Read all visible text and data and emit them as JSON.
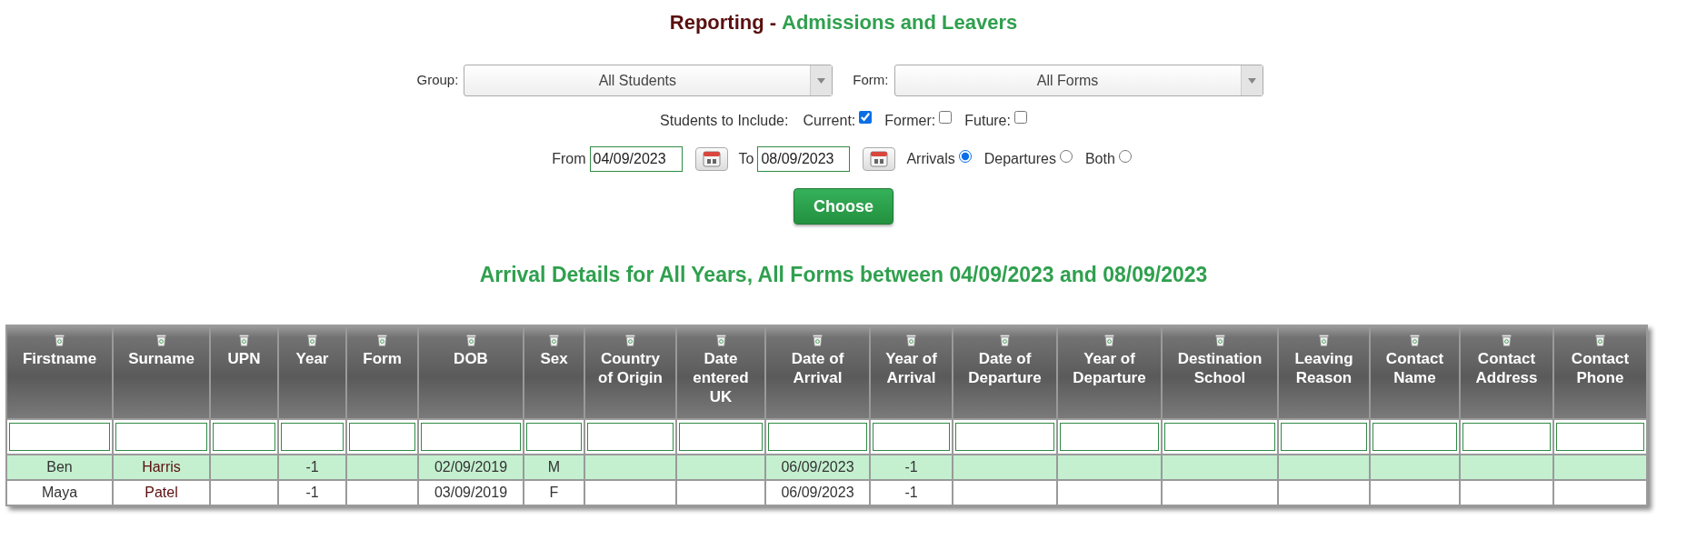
{
  "title": {
    "section": "Reporting",
    "separator": "-",
    "page": "Admissions and Leavers"
  },
  "selects": [
    {
      "label": "Group:",
      "value": "All Students"
    },
    {
      "label": "Form:",
      "value": "All Forms"
    }
  ],
  "include": {
    "label": "Students to Include:",
    "options": [
      {
        "label": "Current:",
        "checked": true
      },
      {
        "label": "Former:",
        "checked": false
      },
      {
        "label": "Future:",
        "checked": false
      }
    ]
  },
  "dates": [
    {
      "label": "From",
      "value": "04/09/2023"
    },
    {
      "label": "To",
      "value": "08/09/2023"
    }
  ],
  "direction": [
    {
      "label": "Arrivals",
      "selected": true
    },
    {
      "label": "Departures",
      "selected": false
    },
    {
      "label": "Both",
      "selected": false
    }
  ],
  "choose_button": "Choose",
  "report_heading": "Arrival Details for All Years, All Forms between 04/09/2023 and 08/09/2023",
  "table": {
    "columns": [
      "Firstname",
      "Surname",
      "UPN",
      "Year",
      "Form",
      "DOB",
      "Sex",
      "Country of Origin",
      "Date entered UK",
      "Date of Arrival",
      "Year of Arrival",
      "Date of Departure",
      "Year of Departure",
      "Destination School",
      "Leaving Reason",
      "Contact Name",
      "Contact Address",
      "Contact Phone"
    ],
    "rows": [
      {
        "selected": true,
        "cells": [
          "Ben",
          "Harris",
          "",
          "-1",
          "",
          "02/09/2019",
          "M",
          "",
          "",
          "06/09/2023",
          "-1",
          "",
          "",
          "",
          "",
          "",
          "",
          ""
        ]
      },
      {
        "selected": false,
        "cells": [
          "Maya",
          "Patel",
          "",
          "-1",
          "",
          "03/09/2019",
          "F",
          "",
          "",
          "06/09/2023",
          "-1",
          "",
          "",
          "",
          "",
          "",
          "",
          ""
        ]
      }
    ]
  }
}
